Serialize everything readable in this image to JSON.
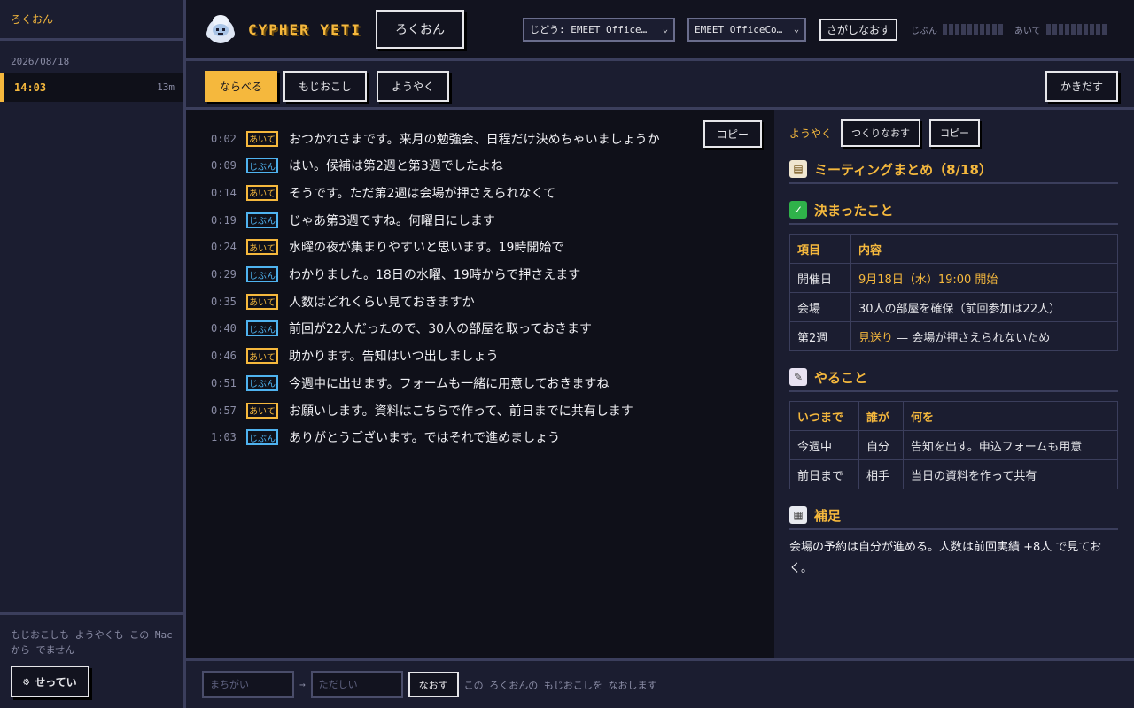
{
  "sidebar": {
    "title": "ろくおん",
    "date": "2026/08/18",
    "session": {
      "time": "14:03",
      "duration": "13m"
    },
    "note": "もじおこしも ようやくも この Mac から でません",
    "settings_icon": "gear-icon",
    "settings_label": "せってい"
  },
  "header": {
    "brand": "CYPHER YETI",
    "logo_icon": "yeti-icon",
    "record_label": "ろくおん",
    "input_select": "じどう: EMEET Office…",
    "device_select": "EMEET OfficeCo…",
    "search_label": "さがしなおす",
    "meter_self_label": "じぶん",
    "meter_other_label": "あいて"
  },
  "toolbar": {
    "tabs": [
      {
        "label": "ならべる",
        "active": true
      },
      {
        "label": "もじおこし",
        "active": false
      },
      {
        "label": "ようやく",
        "active": false
      }
    ],
    "export_label": "かきだす"
  },
  "transcript": {
    "copy_label": "コピー",
    "lines": [
      {
        "time": "0:02",
        "speaker": "あいて",
        "kind": "aite",
        "text": "おつかれさまです。来月の勉強会、日程だけ決めちゃいましょうか"
      },
      {
        "time": "0:09",
        "speaker": "じぶん",
        "kind": "jibun",
        "text": "はい。候補は第2週と第3週でしたよね"
      },
      {
        "time": "0:14",
        "speaker": "あいて",
        "kind": "aite",
        "text": "そうです。ただ第2週は会場が押さえられなくて"
      },
      {
        "time": "0:19",
        "speaker": "じぶん",
        "kind": "jibun",
        "text": "じゃあ第3週ですね。何曜日にします"
      },
      {
        "time": "0:24",
        "speaker": "あいて",
        "kind": "aite",
        "text": "水曜の夜が集まりやすいと思います。19時開始で"
      },
      {
        "time": "0:29",
        "speaker": "じぶん",
        "kind": "jibun",
        "text": "わかりました。18日の水曜、19時からで押さえます"
      },
      {
        "time": "0:35",
        "speaker": "あいて",
        "kind": "aite",
        "text": "人数はどれくらい見ておきますか"
      },
      {
        "time": "0:40",
        "speaker": "じぶん",
        "kind": "jibun",
        "text": "前回が22人だったので、30人の部屋を取っておきます"
      },
      {
        "time": "0:46",
        "speaker": "あいて",
        "kind": "aite",
        "text": "助かります。告知はいつ出しましょう"
      },
      {
        "time": "0:51",
        "speaker": "じぶん",
        "kind": "jibun",
        "text": "今週中に出せます。フォームも一緒に用意しておきますね"
      },
      {
        "time": "0:57",
        "speaker": "あいて",
        "kind": "aite",
        "text": "お願いします。資料はこちらで作って、前日までに共有します"
      },
      {
        "time": "1:03",
        "speaker": "じぶん",
        "kind": "jibun",
        "text": "ありがとうございます。ではそれで進めましょう"
      }
    ]
  },
  "summary": {
    "label": "ようやく",
    "regen_label": "つくりなおす",
    "copy_label": "コピー",
    "title_icon": "clipboard-icon",
    "title": "ミーティングまとめ（8/18）",
    "decided": {
      "icon": "check-icon",
      "heading": "決まったこと",
      "headers": [
        "項目",
        "内容"
      ],
      "rows": [
        {
          "item": "開催日",
          "content": "9月18日（水）19:00 開始",
          "content_suffix": ""
        },
        {
          "item": "会場",
          "content": "30人の部屋を確保（前回参加は22人）",
          "content_suffix": ""
        },
        {
          "item": "第2週",
          "content": "見送り",
          "content_suffix": " — 会場が押さえられないため"
        }
      ]
    },
    "todo": {
      "icon": "memo-icon",
      "heading": "やること",
      "headers": [
        "いつまで",
        "誰が",
        "何を"
      ],
      "rows": [
        {
          "when": "今週中",
          "who": "自分",
          "what": "告知を出す。申込フォームも用意"
        },
        {
          "when": "前日まで",
          "who": "相手",
          "what": "当日の資料を作って共有"
        }
      ]
    },
    "extra": {
      "icon": "note-icon",
      "heading": "補足",
      "text": "会場の予約は自分が進める。人数は前回実績 +8人 で見ておく。"
    }
  },
  "correction": {
    "wrong_placeholder": "まちがい",
    "arrow": "→",
    "right_placeholder": "ただしい",
    "fix_label": "なおす",
    "note": "この ろくおんの もじおこしを なおします"
  },
  "colors": {
    "accent": "#f5b83d",
    "self": "#4fb3f0",
    "background": "#12131f",
    "panel": "#1b1d30"
  }
}
